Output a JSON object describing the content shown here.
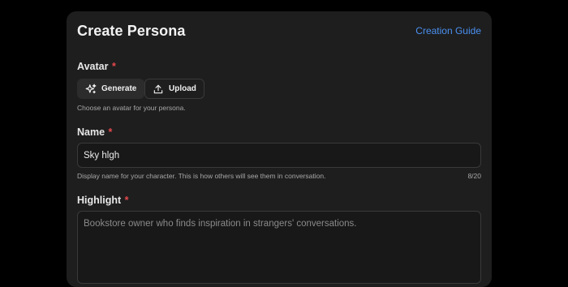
{
  "header": {
    "title": "Create Persona",
    "guide_link": "Creation Guide"
  },
  "avatar": {
    "label": "Avatar",
    "required_mark": "*",
    "generate_label": "Generate",
    "upload_label": "Upload",
    "help": "Choose an avatar for your persona."
  },
  "name": {
    "label": "Name",
    "required_mark": "*",
    "value": "Sky hlgh",
    "help": "Display name for your character. This is how others will see them in conversation.",
    "counter": "8/20"
  },
  "highlight": {
    "label": "Highlight",
    "required_mark": "*",
    "placeholder": "Bookstore owner who finds inspiration in strangers' conversations."
  },
  "colors": {
    "background": "#000000",
    "card": "#1e1e1e",
    "accent_link": "#4a90f0",
    "required": "#e5484d"
  },
  "icons": {
    "generate": "sparkles-icon",
    "upload": "upload-icon"
  }
}
